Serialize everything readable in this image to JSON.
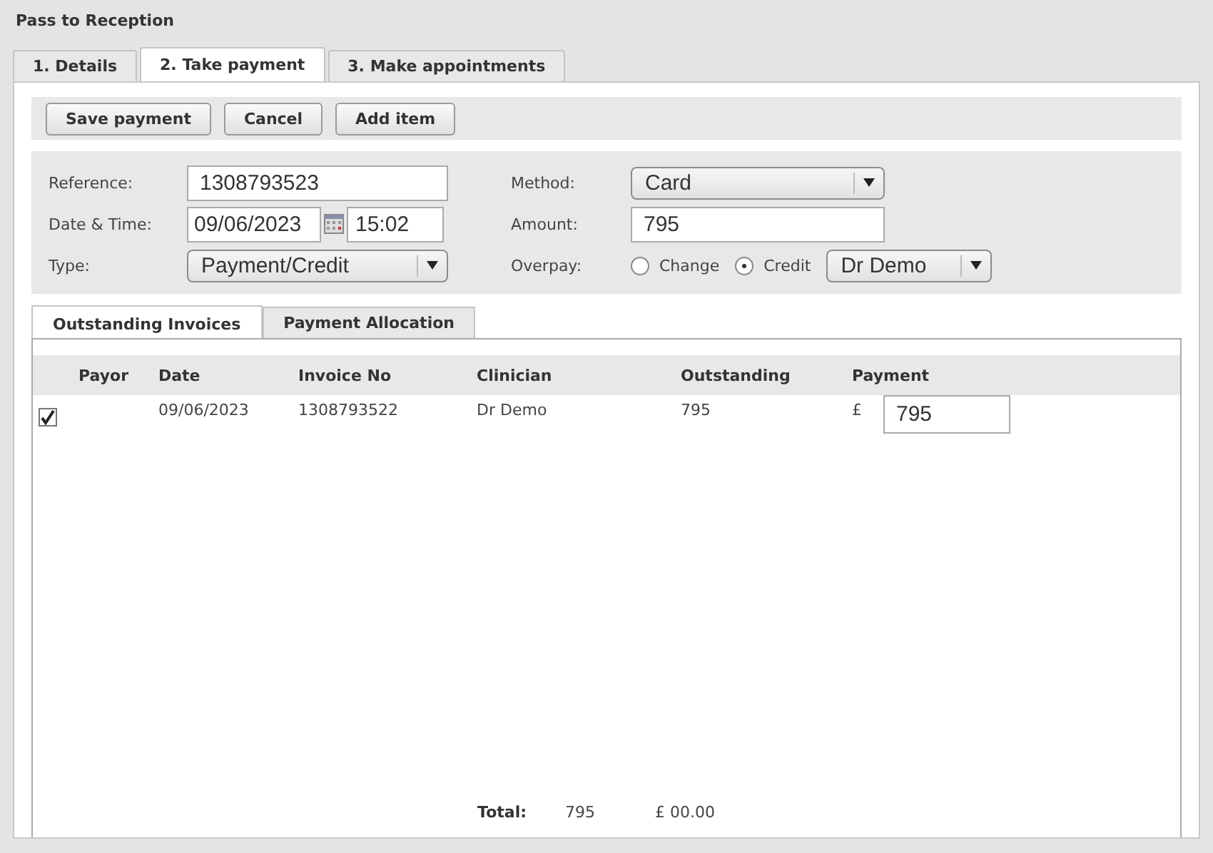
{
  "title": "Pass to Reception",
  "tabs": [
    {
      "label": "1. Details",
      "selected": false
    },
    {
      "label": "2. Take payment",
      "selected": true
    },
    {
      "label": "3. Make appointments",
      "selected": false
    }
  ],
  "toolbar": {
    "buttons": [
      "Save payment",
      "Cancel",
      "Add item"
    ]
  },
  "form": {
    "reference": {
      "label": "Reference:",
      "value": "1308793523"
    },
    "date_time": {
      "label": "Date & Time:",
      "date": "09/06/2023",
      "time": "15:02"
    },
    "type": {
      "label": "Type:",
      "value": "Payment/Credit"
    },
    "method": {
      "label": "Method:",
      "value": "Card"
    },
    "amount": {
      "label": "Amount:",
      "value": "795"
    },
    "overpay": {
      "label": "Overpay:",
      "options": [
        {
          "label": "Change",
          "selected": false
        },
        {
          "label": "Credit",
          "selected": true
        }
      ],
      "clinician": "Dr Demo"
    }
  },
  "inner_tabs": [
    {
      "label": "Outstanding Invoices",
      "selected": true
    },
    {
      "label": "Payment Allocation",
      "selected": false
    }
  ],
  "table": {
    "columns": [
      "Payor",
      "Date",
      "Invoice No",
      "Clinician",
      "Outstanding",
      "Payment"
    ],
    "rows": [
      {
        "checked": true,
        "date": "09/06/2023",
        "invoice_no": "1308793522",
        "clinician": "Dr Demo",
        "outstanding": "795",
        "currency": "£",
        "payment": "795"
      }
    ],
    "total": {
      "label": "Total:",
      "outstanding": "795",
      "payment": "£ 00.00"
    }
  }
}
